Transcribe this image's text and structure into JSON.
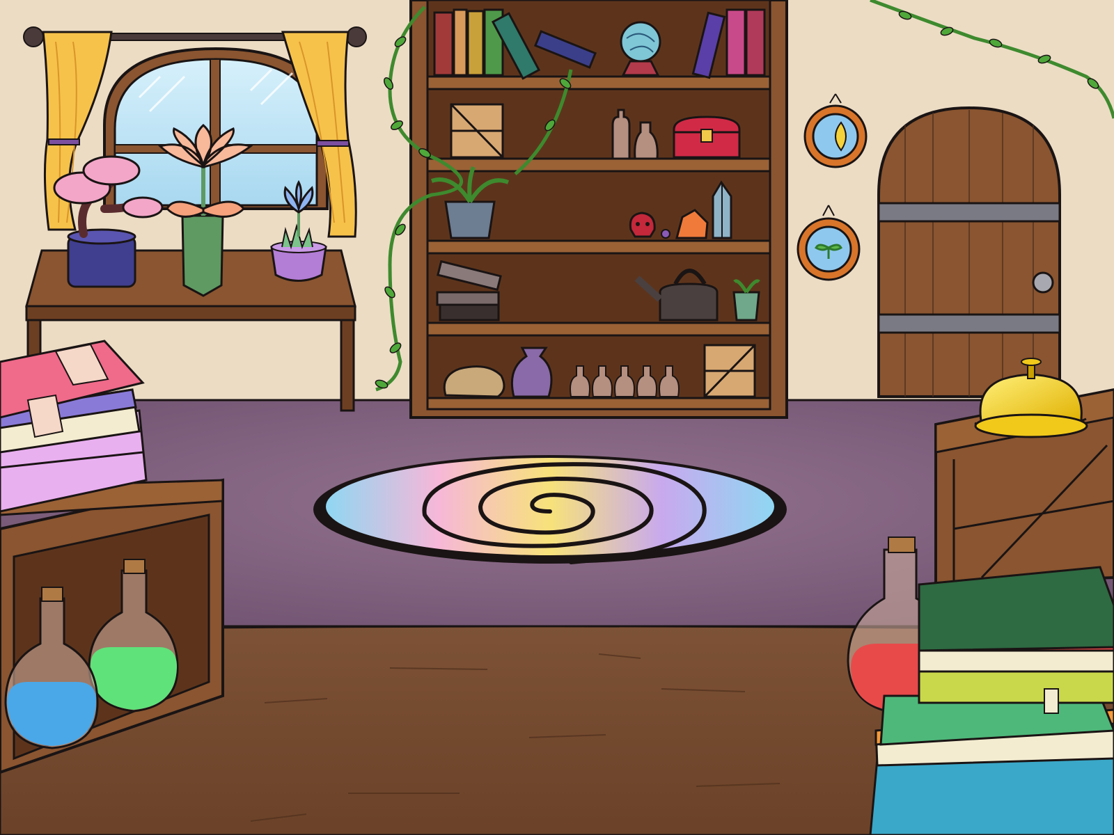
{
  "scene": {
    "title": "",
    "palette": {
      "wall": "#ecdcc4",
      "rug": "#8a6a88",
      "floor": "#7a4f35",
      "wood": "#8a5530",
      "outline": "#1a1414",
      "vine": "#3e8a2e",
      "curtain": "#f6c24a",
      "window_sky": "#bfe3f6",
      "bell": "#f1c91b"
    },
    "objects": [
      {
        "id": "window",
        "icon": "window-icon"
      },
      {
        "id": "side-table",
        "icon": "table-icon"
      },
      {
        "id": "bonsai",
        "icon": "bonsai-icon"
      },
      {
        "id": "lotus-plant",
        "icon": "flower-icon"
      },
      {
        "id": "blue-flower",
        "icon": "flower-icon"
      },
      {
        "id": "bookshelf",
        "icon": "bookshelf-icon"
      },
      {
        "id": "crystal-ball",
        "icon": "crystal-ball-icon"
      },
      {
        "id": "treasure-chest",
        "icon": "chest-icon"
      },
      {
        "id": "watering-can",
        "icon": "watering-can-icon"
      },
      {
        "id": "moon-frame",
        "icon": "moon-icon"
      },
      {
        "id": "sprout-frame",
        "icon": "sprout-icon"
      },
      {
        "id": "wooden-door",
        "icon": "door-icon"
      },
      {
        "id": "swirl-portal",
        "icon": "portal-icon"
      },
      {
        "id": "service-bell",
        "icon": "bell-icon"
      },
      {
        "id": "crate",
        "icon": "crate-icon"
      },
      {
        "id": "potion-blue",
        "icon": "potion-icon"
      },
      {
        "id": "potion-green",
        "icon": "potion-icon"
      },
      {
        "id": "potion-red",
        "icon": "potion-icon"
      },
      {
        "id": "book-stack-left",
        "icon": "books-icon"
      },
      {
        "id": "book-stack-right",
        "icon": "books-icon"
      }
    ]
  }
}
